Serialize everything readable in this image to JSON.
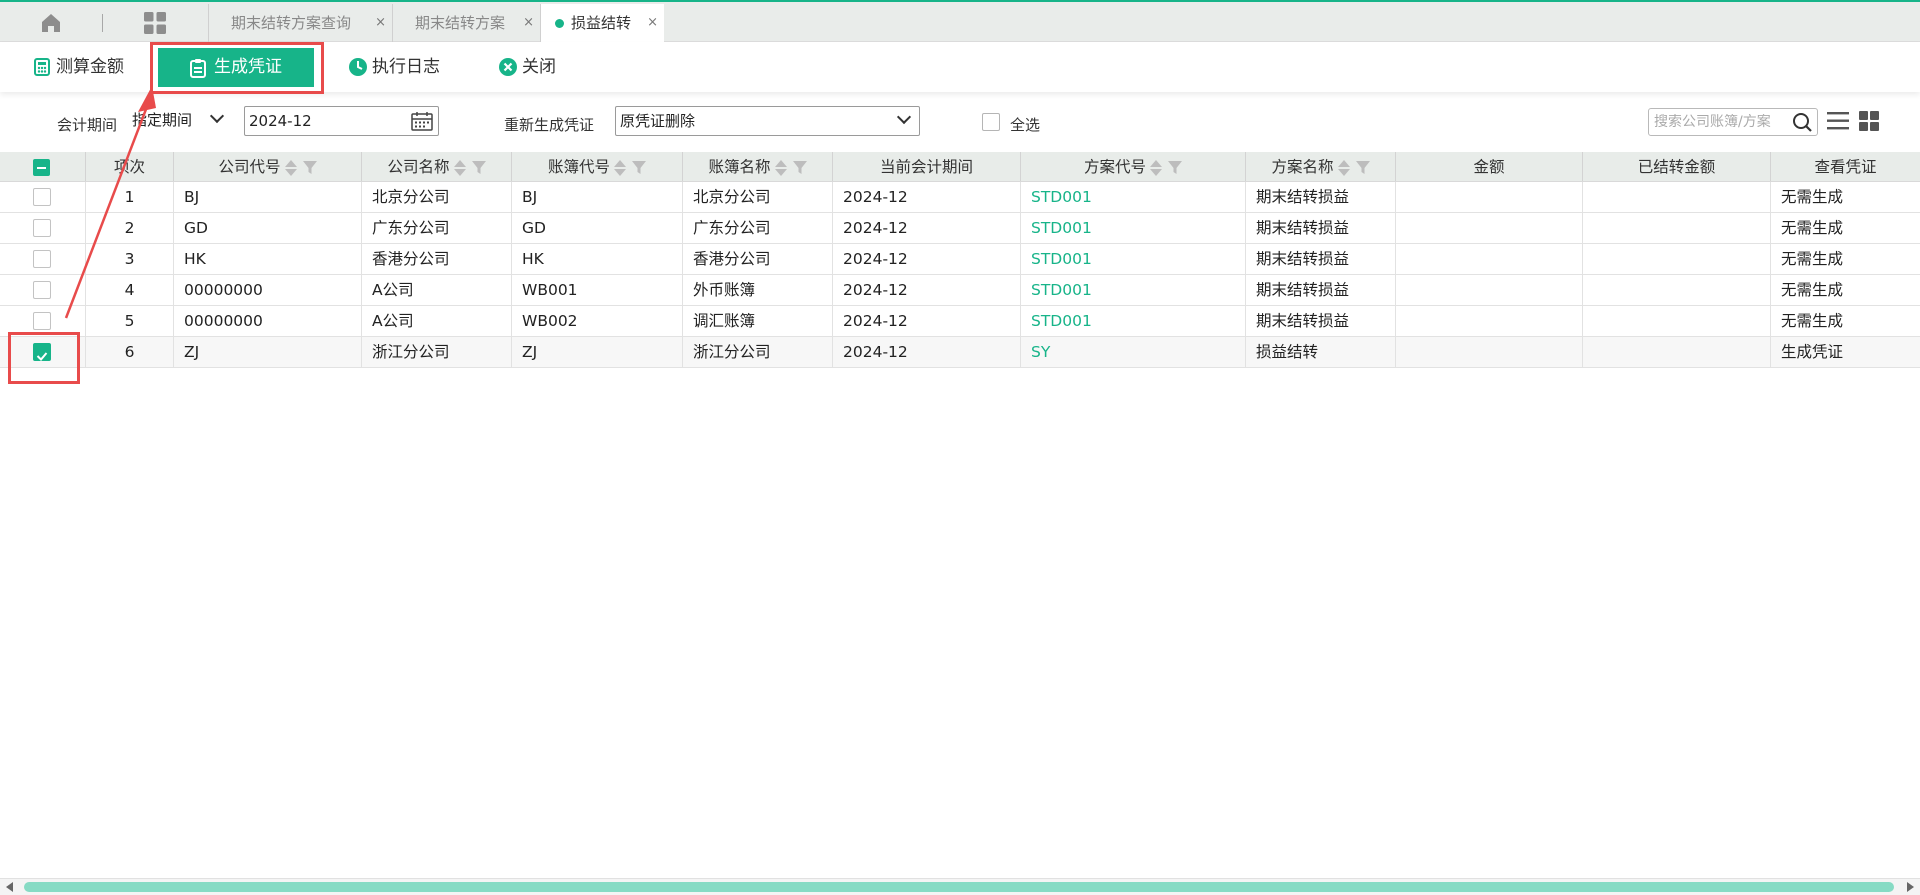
{
  "tabs": {
    "home_icon": "home-icon",
    "apps_icon": "grid-icon",
    "items": [
      {
        "label": "期末结转方案查询",
        "active": false
      },
      {
        "label": "期末结转方案",
        "active": false
      },
      {
        "label": "损益结转",
        "active": true
      }
    ],
    "close_glyph": "×"
  },
  "toolbar": {
    "calc_label": "测算金额",
    "generate_label": "生成凭证",
    "log_label": "执行日志",
    "close_label": "关闭"
  },
  "filter": {
    "period_label": "会计期间",
    "period_mode": "指定期间",
    "period_value": "2024-12",
    "regen_label": "重新生成凭证",
    "regen_value": "原凭证删除",
    "select_all_label": "全选",
    "search_placeholder": "搜索公司账簿/方案"
  },
  "grid": {
    "headers": {
      "seq": "项次",
      "company_code": "公司代号",
      "company_name": "公司名称",
      "book_code": "账簿代号",
      "book_name": "账簿名称",
      "period": "当前会计期间",
      "plan_code": "方案代号",
      "plan_name": "方案名称",
      "amount": "金额",
      "transferred": "已结转金额",
      "voucher": "查看凭证"
    },
    "rows": [
      {
        "seq": "1",
        "company_code": "BJ",
        "company_name": "北京分公司",
        "book_code": "BJ",
        "book_name": "北京分公司",
        "period": "2024-12",
        "plan_code": "STD001",
        "plan_name": "期末结转损益",
        "amount": "",
        "transferred": "",
        "voucher": "无需生成",
        "checked": false
      },
      {
        "seq": "2",
        "company_code": "GD",
        "company_name": "广东分公司",
        "book_code": "GD",
        "book_name": "广东分公司",
        "period": "2024-12",
        "plan_code": "STD001",
        "plan_name": "期末结转损益",
        "amount": "",
        "transferred": "",
        "voucher": "无需生成",
        "checked": false
      },
      {
        "seq": "3",
        "company_code": "HK",
        "company_name": "香港分公司",
        "book_code": "HK",
        "book_name": "香港分公司",
        "period": "2024-12",
        "plan_code": "STD001",
        "plan_name": "期末结转损益",
        "amount": "",
        "transferred": "",
        "voucher": "无需生成",
        "checked": false
      },
      {
        "seq": "4",
        "company_code": "00000000",
        "company_name": "A公司",
        "book_code": "WB001",
        "book_name": "外币账簿",
        "period": "2024-12",
        "plan_code": "STD001",
        "plan_name": "期末结转损益",
        "amount": "",
        "transferred": "",
        "voucher": "无需生成",
        "checked": false
      },
      {
        "seq": "5",
        "company_code": "00000000",
        "company_name": "A公司",
        "book_code": "WB002",
        "book_name": "调汇账簿",
        "period": "2024-12",
        "plan_code": "STD001",
        "plan_name": "期末结转损益",
        "amount": "",
        "transferred": "",
        "voucher": "无需生成",
        "checked": false
      },
      {
        "seq": "6",
        "company_code": "ZJ",
        "company_name": "浙江分公司",
        "book_code": "ZJ",
        "book_name": "浙江分公司",
        "period": "2024-12",
        "plan_code": "SY",
        "plan_name": "损益结转",
        "amount": "",
        "transferred": "",
        "voucher": "生成凭证",
        "checked": true
      }
    ]
  },
  "colors": {
    "accent": "#17b489",
    "annotation": "#e84b4b"
  }
}
